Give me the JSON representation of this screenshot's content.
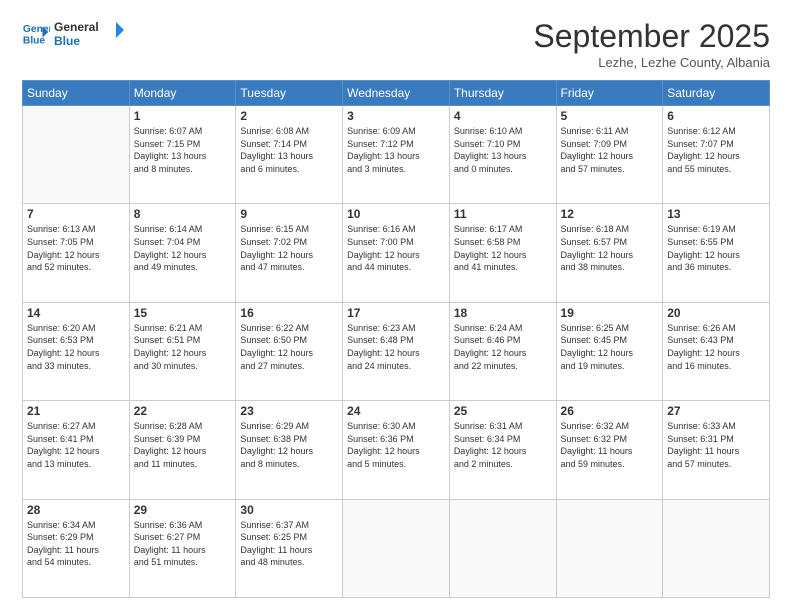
{
  "logo": {
    "line1": "General",
    "line2": "Blue"
  },
  "title": "September 2025",
  "subtitle": "Lezhe, Lezhe County, Albania",
  "days_of_week": [
    "Sunday",
    "Monday",
    "Tuesday",
    "Wednesday",
    "Thursday",
    "Friday",
    "Saturday"
  ],
  "weeks": [
    [
      {
        "day": "",
        "info": ""
      },
      {
        "day": "1",
        "info": "Sunrise: 6:07 AM\nSunset: 7:15 PM\nDaylight: 13 hours\nand 8 minutes."
      },
      {
        "day": "2",
        "info": "Sunrise: 6:08 AM\nSunset: 7:14 PM\nDaylight: 13 hours\nand 6 minutes."
      },
      {
        "day": "3",
        "info": "Sunrise: 6:09 AM\nSunset: 7:12 PM\nDaylight: 13 hours\nand 3 minutes."
      },
      {
        "day": "4",
        "info": "Sunrise: 6:10 AM\nSunset: 7:10 PM\nDaylight: 13 hours\nand 0 minutes."
      },
      {
        "day": "5",
        "info": "Sunrise: 6:11 AM\nSunset: 7:09 PM\nDaylight: 12 hours\nand 57 minutes."
      },
      {
        "day": "6",
        "info": "Sunrise: 6:12 AM\nSunset: 7:07 PM\nDaylight: 12 hours\nand 55 minutes."
      }
    ],
    [
      {
        "day": "7",
        "info": "Sunrise: 6:13 AM\nSunset: 7:05 PM\nDaylight: 12 hours\nand 52 minutes."
      },
      {
        "day": "8",
        "info": "Sunrise: 6:14 AM\nSunset: 7:04 PM\nDaylight: 12 hours\nand 49 minutes."
      },
      {
        "day": "9",
        "info": "Sunrise: 6:15 AM\nSunset: 7:02 PM\nDaylight: 12 hours\nand 47 minutes."
      },
      {
        "day": "10",
        "info": "Sunrise: 6:16 AM\nSunset: 7:00 PM\nDaylight: 12 hours\nand 44 minutes."
      },
      {
        "day": "11",
        "info": "Sunrise: 6:17 AM\nSunset: 6:58 PM\nDaylight: 12 hours\nand 41 minutes."
      },
      {
        "day": "12",
        "info": "Sunrise: 6:18 AM\nSunset: 6:57 PM\nDaylight: 12 hours\nand 38 minutes."
      },
      {
        "day": "13",
        "info": "Sunrise: 6:19 AM\nSunset: 6:55 PM\nDaylight: 12 hours\nand 36 minutes."
      }
    ],
    [
      {
        "day": "14",
        "info": "Sunrise: 6:20 AM\nSunset: 6:53 PM\nDaylight: 12 hours\nand 33 minutes."
      },
      {
        "day": "15",
        "info": "Sunrise: 6:21 AM\nSunset: 6:51 PM\nDaylight: 12 hours\nand 30 minutes."
      },
      {
        "day": "16",
        "info": "Sunrise: 6:22 AM\nSunset: 6:50 PM\nDaylight: 12 hours\nand 27 minutes."
      },
      {
        "day": "17",
        "info": "Sunrise: 6:23 AM\nSunset: 6:48 PM\nDaylight: 12 hours\nand 24 minutes."
      },
      {
        "day": "18",
        "info": "Sunrise: 6:24 AM\nSunset: 6:46 PM\nDaylight: 12 hours\nand 22 minutes."
      },
      {
        "day": "19",
        "info": "Sunrise: 6:25 AM\nSunset: 6:45 PM\nDaylight: 12 hours\nand 19 minutes."
      },
      {
        "day": "20",
        "info": "Sunrise: 6:26 AM\nSunset: 6:43 PM\nDaylight: 12 hours\nand 16 minutes."
      }
    ],
    [
      {
        "day": "21",
        "info": "Sunrise: 6:27 AM\nSunset: 6:41 PM\nDaylight: 12 hours\nand 13 minutes."
      },
      {
        "day": "22",
        "info": "Sunrise: 6:28 AM\nSunset: 6:39 PM\nDaylight: 12 hours\nand 11 minutes."
      },
      {
        "day": "23",
        "info": "Sunrise: 6:29 AM\nSunset: 6:38 PM\nDaylight: 12 hours\nand 8 minutes."
      },
      {
        "day": "24",
        "info": "Sunrise: 6:30 AM\nSunset: 6:36 PM\nDaylight: 12 hours\nand 5 minutes."
      },
      {
        "day": "25",
        "info": "Sunrise: 6:31 AM\nSunset: 6:34 PM\nDaylight: 12 hours\nand 2 minutes."
      },
      {
        "day": "26",
        "info": "Sunrise: 6:32 AM\nSunset: 6:32 PM\nDaylight: 11 hours\nand 59 minutes."
      },
      {
        "day": "27",
        "info": "Sunrise: 6:33 AM\nSunset: 6:31 PM\nDaylight: 11 hours\nand 57 minutes."
      }
    ],
    [
      {
        "day": "28",
        "info": "Sunrise: 6:34 AM\nSunset: 6:29 PM\nDaylight: 11 hours\nand 54 minutes."
      },
      {
        "day": "29",
        "info": "Sunrise: 6:36 AM\nSunset: 6:27 PM\nDaylight: 11 hours\nand 51 minutes."
      },
      {
        "day": "30",
        "info": "Sunrise: 6:37 AM\nSunset: 6:25 PM\nDaylight: 11 hours\nand 48 minutes."
      },
      {
        "day": "",
        "info": ""
      },
      {
        "day": "",
        "info": ""
      },
      {
        "day": "",
        "info": ""
      },
      {
        "day": "",
        "info": ""
      }
    ]
  ]
}
